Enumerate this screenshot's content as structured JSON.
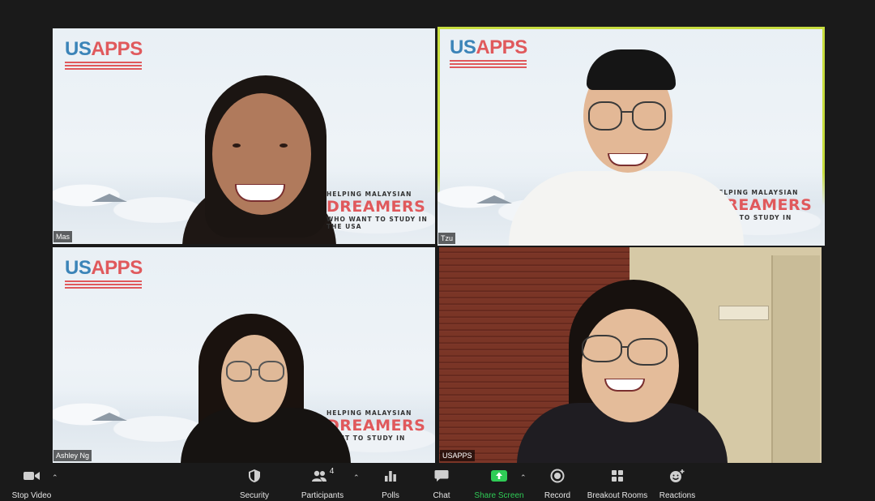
{
  "tiles": [
    {
      "name": "Mas",
      "logo_us": "US",
      "logo_apps": "APPS",
      "slogan_top": "HELPING MALAYSIAN",
      "slogan_main": "DREAMERS",
      "slogan_bottom_1": "WHO WANT TO STUDY IN",
      "slogan_bottom_2": "THE USA"
    },
    {
      "name": "Tzu",
      "logo_us": "US",
      "logo_apps": "APPS",
      "slogan_top": "HELPING MALAYSIAN",
      "slogan_main": "DREAMERS",
      "slogan_bottom_1": "WANT TO STUDY IN",
      "active": true,
      "active_color": "#c7dd3f"
    },
    {
      "name": "Ashley Ng",
      "logo_us": "US",
      "logo_apps": "APPS",
      "slogan_top": "HELPING MALAYSIAN",
      "slogan_main": "DREAMERS",
      "slogan_bottom_1": "WANT TO STUDY IN"
    },
    {
      "name": "USAPPS"
    }
  ],
  "toolbar": {
    "stop_video": "Stop Video",
    "security": "Security",
    "participants": "Participants",
    "participants_count": "4",
    "polls": "Polls",
    "chat": "Chat",
    "share_screen": "Share Screen",
    "record": "Record",
    "breakout_rooms": "Breakout Rooms",
    "reactions": "Reactions",
    "share_color": "#2fcc56"
  },
  "colors": {
    "logo_blue": "#3b84b8",
    "logo_red": "#e0595c",
    "background": "#1a1a1a"
  }
}
